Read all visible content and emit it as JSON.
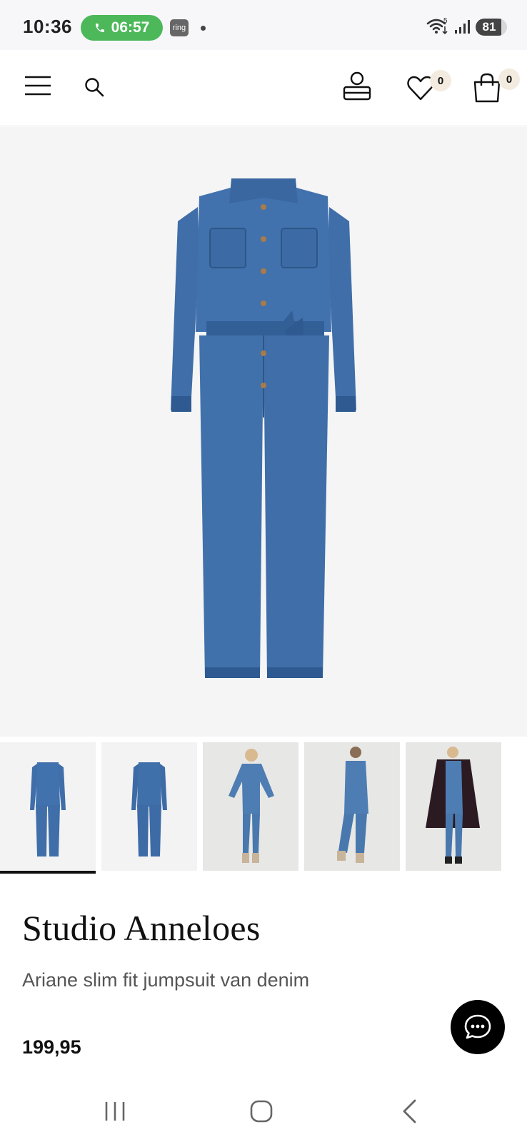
{
  "status_bar": {
    "time": "10:36",
    "call_timer": "06:57",
    "app_badge": "ring",
    "wifi_label": "5",
    "battery_level": "81",
    "battery_fraction": 0.81
  },
  "header": {
    "wishlist_count": "0",
    "cart_count": "0",
    "icons": [
      "menu-icon",
      "search-icon",
      "account-icon",
      "heart-icon",
      "shopping-bag-icon"
    ]
  },
  "gallery": {
    "selected_index": 0,
    "thumbnail_count": 5
  },
  "product": {
    "brand": "Studio Anneloes",
    "description": "Ariane slim fit jumpsuit van denim",
    "price": "199,95"
  },
  "colors": {
    "denim": "#3f6ea9",
    "denim_dark": "#2f5a91",
    "call_green": "#4cb85a",
    "badge_bg": "#f3ebe0",
    "image_bg": "#f5f5f5"
  }
}
